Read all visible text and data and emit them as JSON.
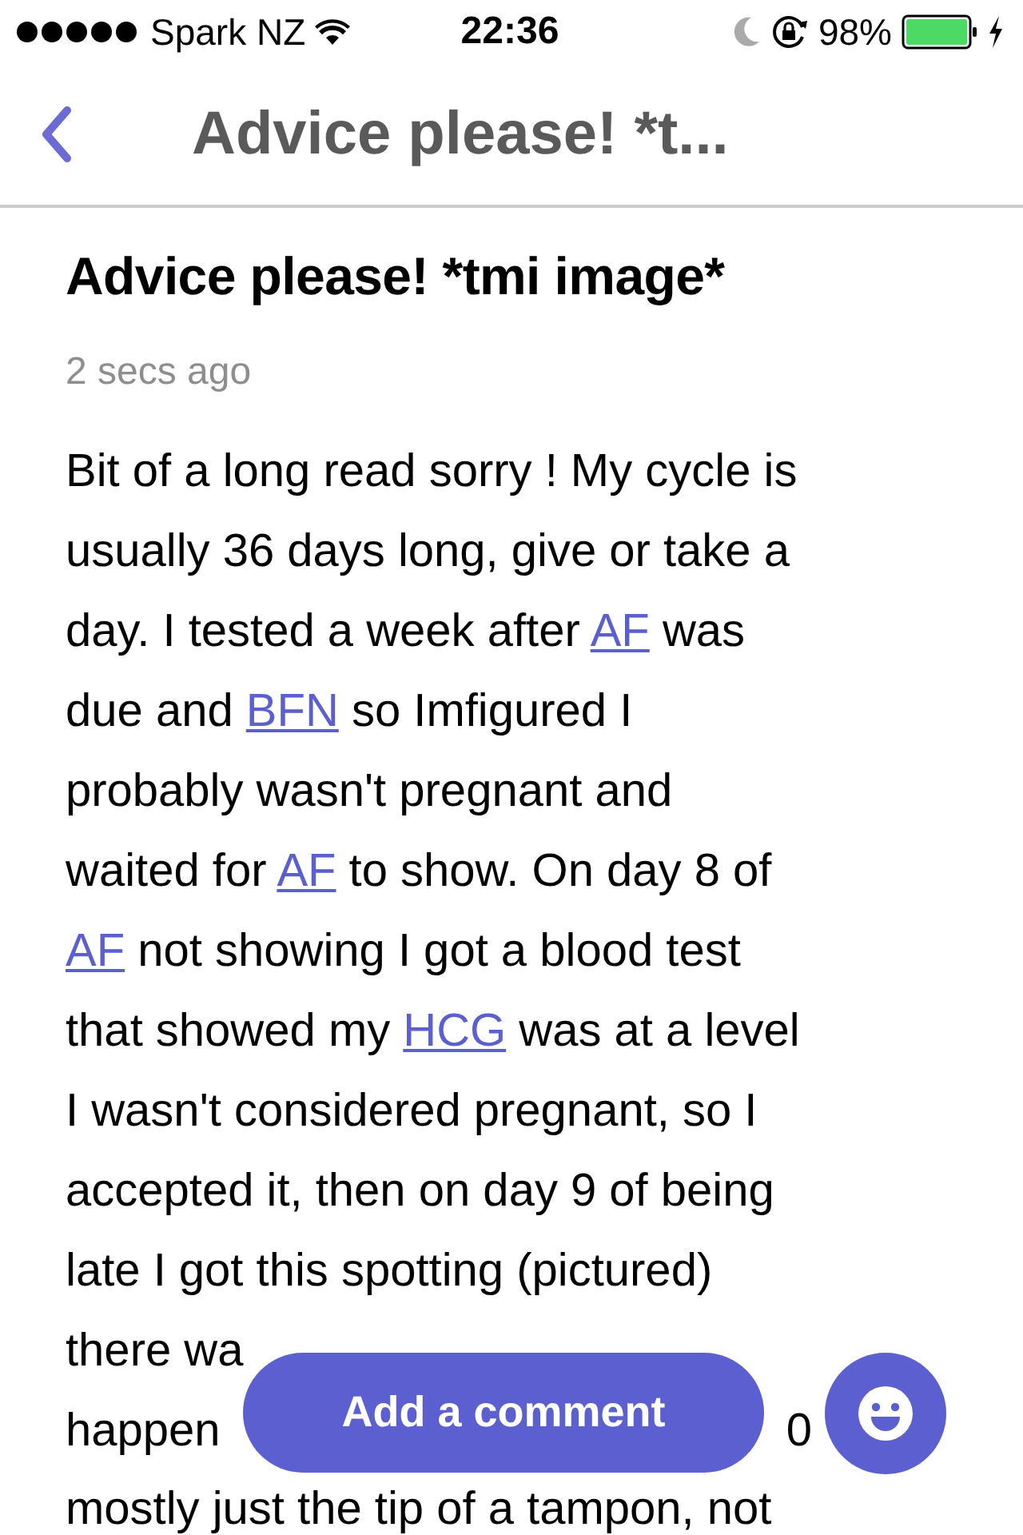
{
  "status_bar": {
    "carrier": "Spark NZ",
    "time": "22:36",
    "battery": "98%"
  },
  "nav": {
    "title": "Advice please! *t..."
  },
  "post": {
    "title": "Advice please! *tmi image*",
    "time": "2 secs ago",
    "lines": [
      [
        {
          "text": "Bit of a long read sorry ! My cycle is",
          "kind": "text"
        }
      ],
      [
        {
          "text": "usually 36 days long, give or take a",
          "kind": "text"
        }
      ],
      [
        {
          "text": "day. I tested a week after ",
          "kind": "text"
        },
        {
          "text": "AF",
          "kind": "link"
        },
        {
          "text": " was",
          "kind": "text"
        }
      ],
      [
        {
          "text": "due and ",
          "kind": "text"
        },
        {
          "text": "BFN",
          "kind": "link"
        },
        {
          "text": " so Imfigured I",
          "kind": "text"
        }
      ],
      [
        {
          "text": "probably wasn't pregnant and",
          "kind": "text"
        }
      ],
      [
        {
          "text": "waited for ",
          "kind": "text"
        },
        {
          "text": "AF",
          "kind": "link"
        },
        {
          "text": " to show. On day 8 of",
          "kind": "text"
        }
      ],
      [
        {
          "text": "AF",
          "kind": "link"
        },
        {
          "text": " not showing I got a blood test",
          "kind": "text"
        }
      ],
      [
        {
          "text": "that showed my ",
          "kind": "text"
        },
        {
          "text": "HCG",
          "kind": "link"
        },
        {
          "text": " was at a level",
          "kind": "text"
        }
      ],
      [
        {
          "text": "I wasn't considered pregnant, so I",
          "kind": "text"
        }
      ],
      [
        {
          "text": "accepted it, then on day 9 of being",
          "kind": "text"
        }
      ],
      [
        {
          "text": "late I got this spotting (pictured)",
          "kind": "text"
        }
      ]
    ],
    "covered_lines": [
      [
        "there wa"
      ],
      [
        "happen",
        "0"
      ]
    ],
    "last_line": "mostly just the tip of a tampon, not"
  },
  "comment_button": {
    "label": "Add a comment"
  }
}
